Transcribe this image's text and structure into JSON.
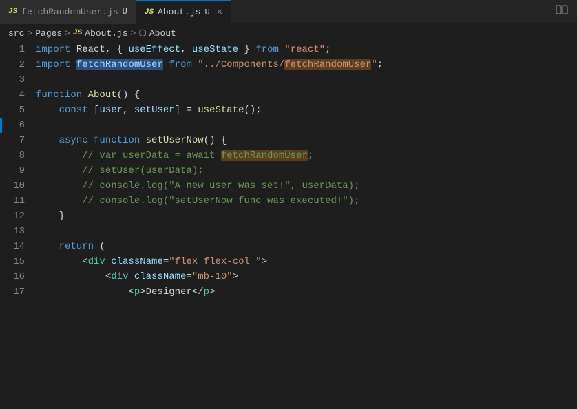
{
  "tabs": [
    {
      "id": "fetchRandomUser",
      "js_label": "JS",
      "label": "fetchRandomUser.js",
      "suffix": "U",
      "active": false,
      "closeable": false
    },
    {
      "id": "About",
      "js_label": "JS",
      "label": "About.js",
      "suffix": "U",
      "active": true,
      "closeable": true
    }
  ],
  "breadcrumb": {
    "src": "src",
    "sep1": ">",
    "pages": "Pages",
    "sep2": ">",
    "js_label": "JS",
    "file": "About.js",
    "sep3": ">",
    "component": "About"
  },
  "lines": [
    {
      "num": "1",
      "tokens": [
        {
          "t": "kw",
          "v": "import"
        },
        {
          "t": "plain",
          "v": " React, { "
        },
        {
          "t": "var",
          "v": "useEffect"
        },
        {
          "t": "plain",
          "v": ", "
        },
        {
          "t": "var",
          "v": "useState"
        },
        {
          "t": "plain",
          "v": " } "
        },
        {
          "t": "kw",
          "v": "from"
        },
        {
          "t": "plain",
          "v": " "
        },
        {
          "t": "str",
          "v": "\"react\""
        },
        {
          "t": "plain",
          "v": ";"
        }
      ]
    },
    {
      "num": "2",
      "tokens": [
        {
          "t": "kw",
          "v": "import"
        },
        {
          "t": "plain",
          "v": " "
        },
        {
          "t": "hl-import",
          "v": "fetchRandomUser"
        },
        {
          "t": "plain",
          "v": " "
        },
        {
          "t": "kw",
          "v": "from"
        },
        {
          "t": "plain",
          "v": " "
        },
        {
          "t": "str",
          "v": "\"../Components/"
        },
        {
          "t": "hl-ref-str",
          "v": "fetchRandomUser"
        },
        {
          "t": "str",
          "v": "\""
        },
        {
          "t": "plain",
          "v": ";"
        }
      ]
    },
    {
      "num": "3",
      "tokens": []
    },
    {
      "num": "4",
      "tokens": [
        {
          "t": "kw",
          "v": "function"
        },
        {
          "t": "plain",
          "v": " "
        },
        {
          "t": "fn",
          "v": "About"
        },
        {
          "t": "plain",
          "v": "() {"
        }
      ]
    },
    {
      "num": "5",
      "tokens": [
        {
          "t": "plain",
          "v": "    "
        },
        {
          "t": "kw",
          "v": "const"
        },
        {
          "t": "plain",
          "v": " ["
        },
        {
          "t": "var",
          "v": "user"
        },
        {
          "t": "plain",
          "v": ", "
        },
        {
          "t": "var",
          "v": "setUser"
        },
        {
          "t": "plain",
          "v": "] = "
        },
        {
          "t": "fn",
          "v": "useState"
        },
        {
          "t": "plain",
          "v": "();"
        }
      ]
    },
    {
      "num": "6",
      "tokens": [],
      "accent": true
    },
    {
      "num": "7",
      "tokens": [
        {
          "t": "plain",
          "v": "    "
        },
        {
          "t": "kw",
          "v": "async"
        },
        {
          "t": "plain",
          "v": " "
        },
        {
          "t": "kw",
          "v": "function"
        },
        {
          "t": "plain",
          "v": " "
        },
        {
          "t": "fn",
          "v": "setUserNow"
        },
        {
          "t": "plain",
          "v": "() {"
        }
      ]
    },
    {
      "num": "8",
      "tokens": [
        {
          "t": "comment",
          "v": "        // var userData = await "
        },
        {
          "t": "hl-ref-comment",
          "v": "fetchRandomUser"
        },
        {
          "t": "comment",
          "v": ";"
        }
      ]
    },
    {
      "num": "9",
      "tokens": [
        {
          "t": "comment",
          "v": "        // setUser(userData);"
        }
      ]
    },
    {
      "num": "10",
      "tokens": [
        {
          "t": "comment",
          "v": "        // console.log(\"A new user was set!\", userData);"
        }
      ]
    },
    {
      "num": "11",
      "tokens": [
        {
          "t": "comment",
          "v": "        // console.log(\"setUserNow func was executed!\");"
        }
      ]
    },
    {
      "num": "12",
      "tokens": [
        {
          "t": "plain",
          "v": "    }"
        }
      ]
    },
    {
      "num": "13",
      "tokens": []
    },
    {
      "num": "14",
      "tokens": [
        {
          "t": "plain",
          "v": "    "
        },
        {
          "t": "kw",
          "v": "return"
        },
        {
          "t": "plain",
          "v": " ("
        }
      ]
    },
    {
      "num": "15",
      "tokens": [
        {
          "t": "plain",
          "v": "        <"
        },
        {
          "t": "tag",
          "v": "div"
        },
        {
          "t": "plain",
          "v": " "
        },
        {
          "t": "attr",
          "v": "className"
        },
        {
          "t": "plain",
          "v": "="
        },
        {
          "t": "str",
          "v": "\"flex flex-col \""
        },
        {
          "t": "plain",
          "v": ">"
        }
      ]
    },
    {
      "num": "16",
      "tokens": [
        {
          "t": "plain",
          "v": "            <"
        },
        {
          "t": "tag",
          "v": "div"
        },
        {
          "t": "plain",
          "v": " "
        },
        {
          "t": "attr",
          "v": "className"
        },
        {
          "t": "plain",
          "v": "="
        },
        {
          "t": "str",
          "v": "\"mb-10\""
        },
        {
          "t": "plain",
          "v": ">"
        }
      ]
    },
    {
      "num": "17",
      "tokens": [
        {
          "t": "plain",
          "v": "                <"
        },
        {
          "t": "tag",
          "v": "p"
        },
        {
          "t": "plain",
          "v": ">Designer</"
        },
        {
          "t": "tag",
          "v": "p"
        },
        {
          "t": "plain",
          "v": ">"
        }
      ]
    }
  ]
}
